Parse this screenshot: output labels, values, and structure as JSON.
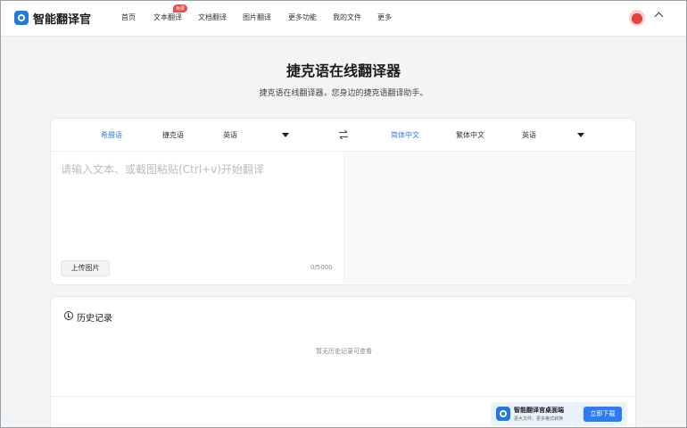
{
  "app": {
    "name": "智能翻译官"
  },
  "nav": {
    "items": [
      {
        "label": "首页"
      },
      {
        "label": "文本翻译",
        "badge": "免费"
      },
      {
        "label": "文档翻译"
      },
      {
        "label": "图片翻译"
      },
      {
        "label": "更多功能"
      },
      {
        "label": "我的文件"
      },
      {
        "label": "更多"
      }
    ]
  },
  "hero": {
    "title": "捷克语在线翻译器",
    "subtitle": "捷克语在线翻译器，您身边的捷克语翻译助手。"
  },
  "translator": {
    "source_langs": [
      "希腊语",
      "捷克语",
      "英语"
    ],
    "source_active": "希腊语",
    "target_langs": [
      "简体中文",
      "繁体中文",
      "英语"
    ],
    "target_active": "简体中文",
    "placeholder": "请输入文本、或截图粘贴(Ctrl+v)开始翻译",
    "upload_label": "上传图片",
    "char_count": "0/5000"
  },
  "history": {
    "title": "历史记录",
    "empty_text": "暂无历史记录可查看"
  },
  "banner": {
    "title": "智能翻译官桌面端",
    "subtitle": "更大文件、更多格式转换",
    "button_label": "立即下载"
  },
  "colors": {
    "accent": "#2f7cf0",
    "badge": "#f04848",
    "background": "#f3f4f6"
  }
}
